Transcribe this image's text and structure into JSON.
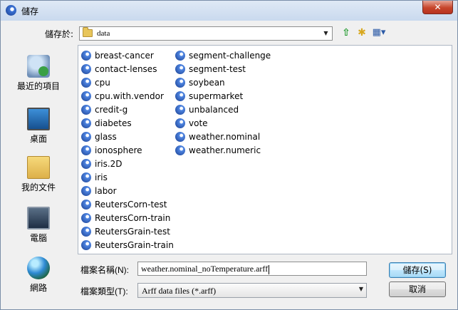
{
  "window": {
    "title": "儲存",
    "close_label": "✕"
  },
  "toolbar": {
    "location_label": "儲存於:",
    "location_value": "data",
    "icons": [
      "up-folder-icon",
      "new-folder-icon",
      "view-menu-icon"
    ]
  },
  "places": [
    {
      "label": "最近的項目",
      "icon": "recent-items-icon"
    },
    {
      "label": "桌面",
      "icon": "desktop-icon"
    },
    {
      "label": "我的文件",
      "icon": "documents-icon"
    },
    {
      "label": "電腦",
      "icon": "computer-icon"
    },
    {
      "label": "網路",
      "icon": "network-icon"
    }
  ],
  "files": {
    "column_a": [
      "breast-cancer",
      "contact-lenses",
      "cpu",
      "cpu.with.vendor",
      "credit-g",
      "diabetes",
      "glass",
      "ionosphere",
      "iris.2D",
      "iris",
      "labor",
      "ReutersCorn-test",
      "ReutersCorn-train",
      "ReutersGrain-test",
      "ReutersGrain-train"
    ],
    "column_b": [
      "segment-challenge",
      "segment-test",
      "soybean",
      "supermarket",
      "unbalanced",
      "vote",
      "weather.nominal",
      "weather.numeric"
    ]
  },
  "form": {
    "filename_label": "檔案名稱(N):",
    "filename_value": "weather.nominal_noTemperature.arff",
    "filetype_label": "檔案類型(T):",
    "filetype_value": "Arff data files (*.arff)"
  },
  "buttons": {
    "save": "儲存(S)",
    "cancel": "取消"
  }
}
